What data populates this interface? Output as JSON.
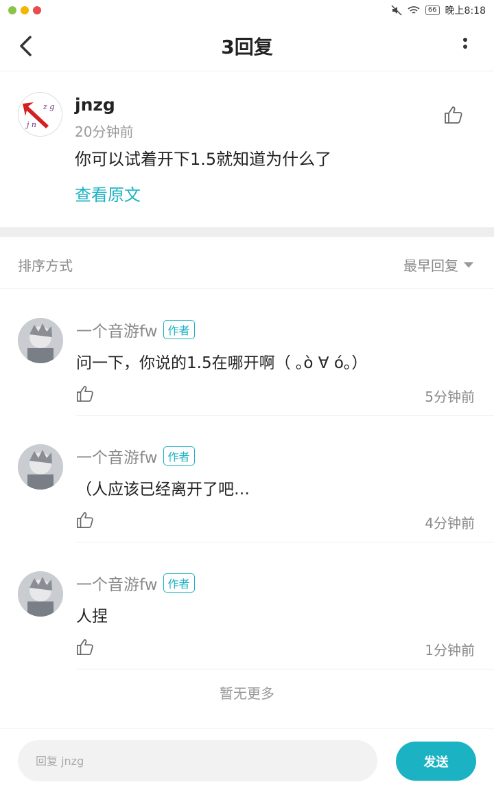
{
  "status_bar": {
    "battery": "66",
    "time": "晚上8:18",
    "app_icon_colors": [
      "#8bc34a",
      "#f5b400",
      "#e84c4c"
    ]
  },
  "header": {
    "title": "3回复"
  },
  "original_comment": {
    "author": "jnzg",
    "time": "20分钟前",
    "text": "你可以试着开下1.5就知道为什么了",
    "view_original": "查看原文"
  },
  "sort": {
    "label": "排序方式",
    "value": "最早回复"
  },
  "replies": [
    {
      "author": "一个音游fw",
      "tag": "作者",
      "text": "问一下，你说的1.5在哪开啊（ ｡ò ∀ ó｡）",
      "time": "5分钟前"
    },
    {
      "author": "一个音游fw",
      "tag": "作者",
      "text": "（人应该已经离开了吧…",
      "time": "4分钟前"
    },
    {
      "author": "一个音游fw",
      "tag": "作者",
      "text": "人捏",
      "time": "1分钟前"
    }
  ],
  "no_more": "暂无更多",
  "input": {
    "placeholder": "回复 jnzg"
  },
  "send_label": "发送",
  "colors": {
    "accent": "#1bb3c4",
    "divider": "#eeeeee"
  }
}
